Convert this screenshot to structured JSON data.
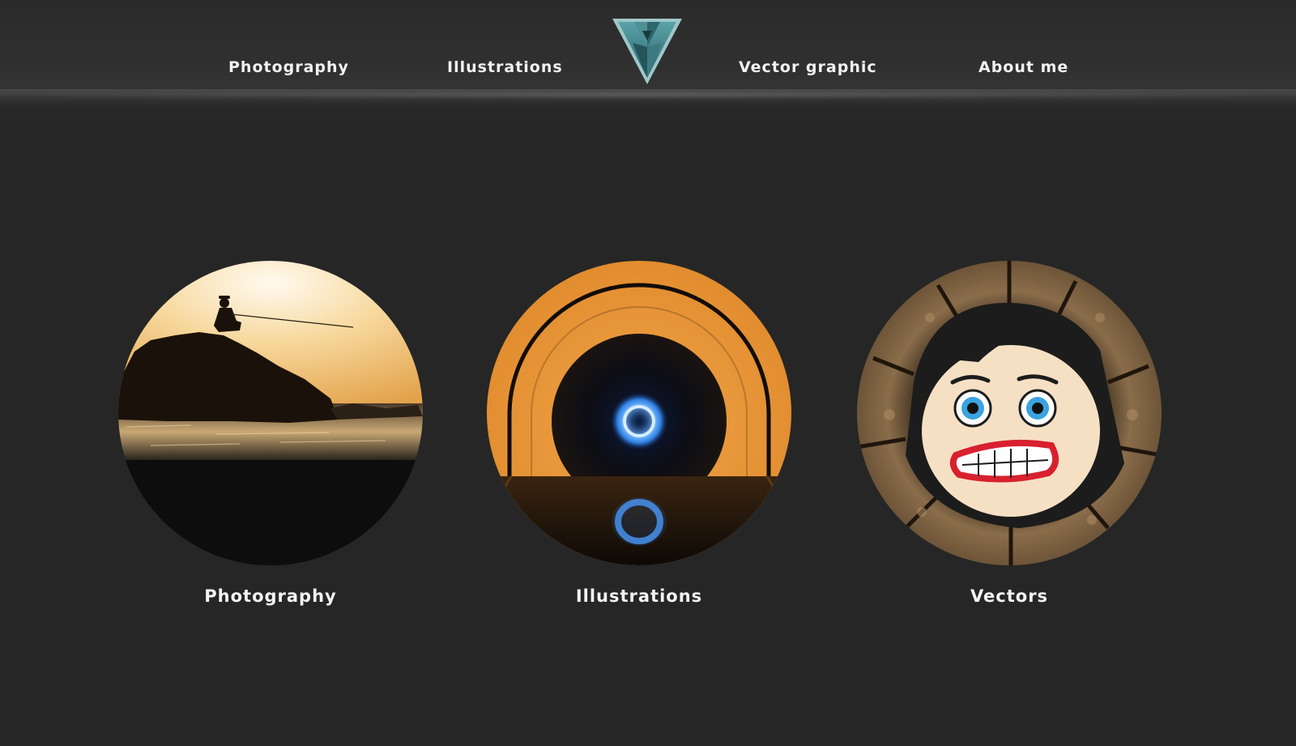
{
  "nav": {
    "items": [
      {
        "label": "Photography"
      },
      {
        "label": "Illustrations"
      },
      {
        "label": "Vector graphic"
      },
      {
        "label": "About me"
      }
    ]
  },
  "logo": {
    "icon": "triangle-logo-icon",
    "color": "#3f7f86"
  },
  "cards": [
    {
      "label": "Photography",
      "image": "fisherman-sunset-photo"
    },
    {
      "label": "Illustrations",
      "image": "orange-portal-illustration"
    },
    {
      "label": "Vectors",
      "image": "scared-face-vector"
    }
  ],
  "colors": {
    "background": "#262626",
    "text": "#f2f2f2",
    "accent": "#3f7f86"
  }
}
